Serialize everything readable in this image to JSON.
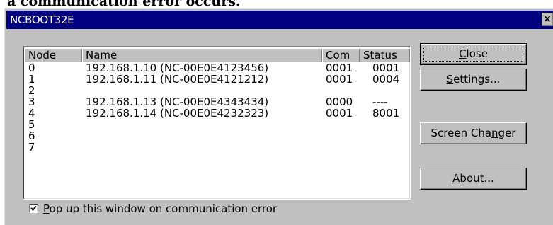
{
  "document": {
    "text_above_dialog": "a communication error occurs."
  },
  "window": {
    "title": "NCBOOT32E",
    "close_glyph": "×"
  },
  "list": {
    "columns": [
      {
        "key": "node",
        "label": "Node"
      },
      {
        "key": "name",
        "label": "Name"
      },
      {
        "key": "com",
        "label": "Com"
      },
      {
        "key": "status",
        "label": "Status"
      }
    ],
    "rows": [
      {
        "node": "0",
        "name": "192.168.1.10 (NC-00E0E4123456)",
        "com": "0001",
        "status": "0001"
      },
      {
        "node": "1",
        "name": "192.168.1.11 (NC-00E0E4121212)",
        "com": "0001",
        "status": "0004"
      },
      {
        "node": "2",
        "name": "",
        "com": "",
        "status": ""
      },
      {
        "node": "3",
        "name": "192.168.1.13 (NC-00E0E4343434)",
        "com": "0000",
        "status": "----"
      },
      {
        "node": "4",
        "name": "192.168.1.14 (NC-00E0E4232323)",
        "com": "0001",
        "status": "8001"
      },
      {
        "node": "5",
        "name": "",
        "com": "",
        "status": ""
      },
      {
        "node": "6",
        "name": "",
        "com": "",
        "status": ""
      },
      {
        "node": "7",
        "name": "",
        "com": "",
        "status": ""
      }
    ]
  },
  "buttons": {
    "close": {
      "pre": "",
      "accel": "C",
      "post": "lose"
    },
    "settings": {
      "pre": "",
      "accel": "S",
      "post": "ettings..."
    },
    "screen_changer": {
      "pre": "Screen Cha",
      "accel": "n",
      "post": "ger"
    },
    "about": {
      "pre": "",
      "accel": "A",
      "post": "bout..."
    }
  },
  "popup_option": {
    "checked": true,
    "pre": "",
    "accel": "P",
    "post": "op up this window on communication error"
  },
  "colors": {
    "titlebar": "#000080",
    "face": "#c0c0c0",
    "list_bg": "#ffffff"
  }
}
